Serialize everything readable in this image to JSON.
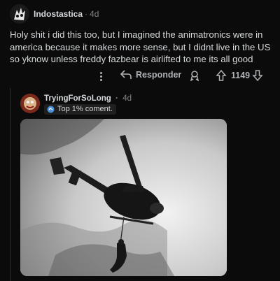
{
  "comment": {
    "username": "Indostastica",
    "separator": "·",
    "time": "4d",
    "body": "Holy shit i did this too, but I imagined the animatronics were in america because it makes more sense, but I didnt live in the US so yknow unless freddy fazbear is airlifted to me its all good",
    "actions": {
      "reply_label": "Responder",
      "score": "1149",
      "icons": [
        "more-icon",
        "reply-icon",
        "award-icon",
        "upvote-icon",
        "downvote-icon"
      ]
    }
  },
  "reply": {
    "username": "TryingForSoLong",
    "separator": "·",
    "time": "4d",
    "flair": "Top 1% coment.",
    "image": "black-and-white photo of a helicopter lifting a person on a rope"
  }
}
